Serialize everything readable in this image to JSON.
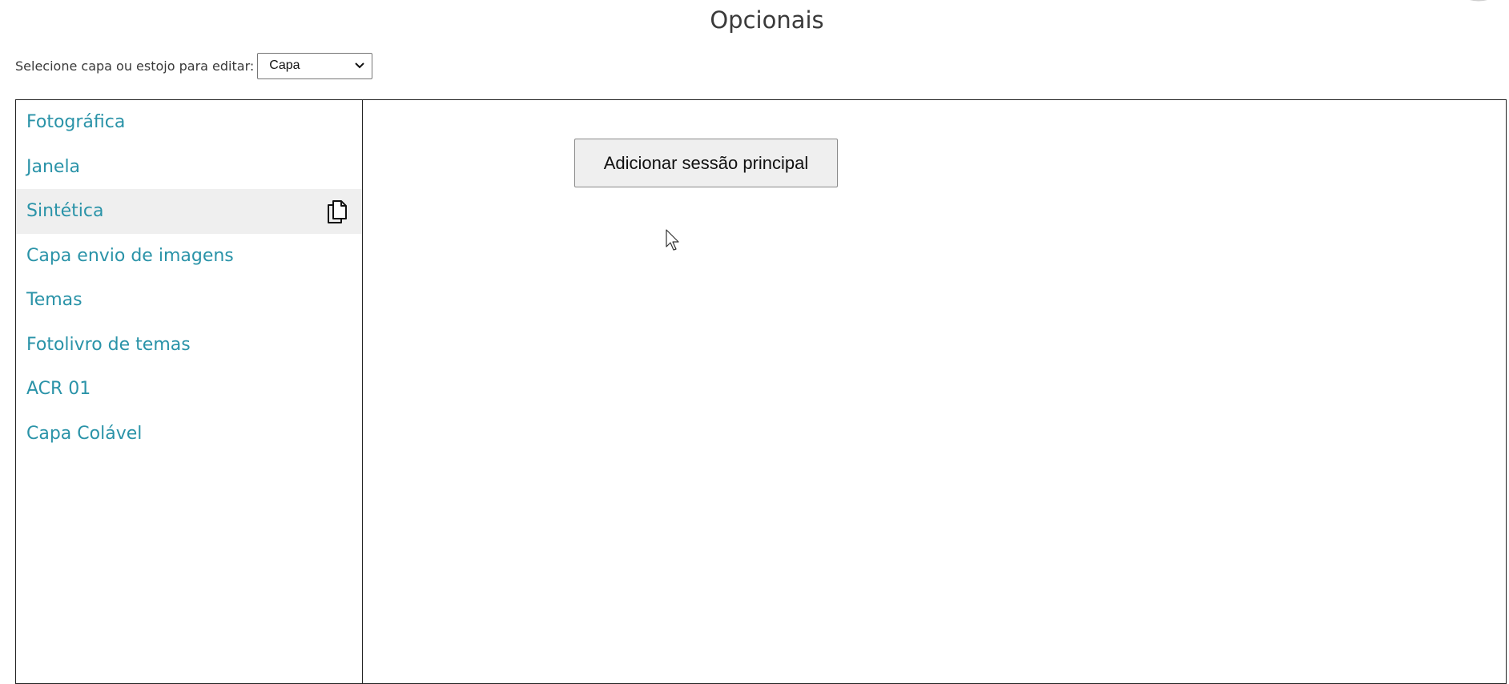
{
  "page": {
    "title": "Opcionais"
  },
  "selector": {
    "label": "Selecione capa ou estojo para editar:",
    "selected": "Capa"
  },
  "sidebar": {
    "items": [
      {
        "label": "Fotográfica"
      },
      {
        "label": "Janela"
      },
      {
        "label": "Sintética",
        "active": true,
        "icon": "copy-icon"
      },
      {
        "label": "Capa envio de imagens"
      },
      {
        "label": "Temas"
      },
      {
        "label": "Fotolivro de temas"
      },
      {
        "label": "ACR 01"
      },
      {
        "label": "Capa Colável"
      }
    ]
  },
  "main": {
    "add_button_label": "Adicionar sessão principal"
  },
  "colors": {
    "link": "#2a93a8",
    "active_bg": "#efefef",
    "border": "#222222"
  }
}
